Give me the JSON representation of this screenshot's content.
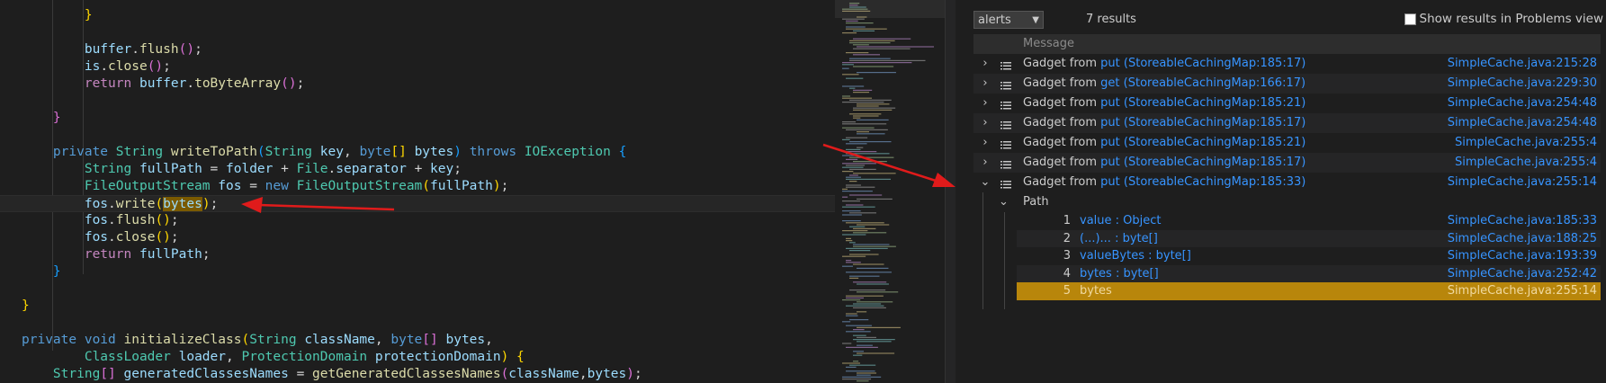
{
  "editor": {
    "lines": [
      {
        "tokens": [
          [
            "p",
            "        "
          ],
          [
            "b",
            "}"
          ]
        ]
      },
      {
        "tokens": [
          [
            "p",
            ""
          ]
        ]
      },
      {
        "tokens": [
          [
            "p",
            "        "
          ],
          [
            "v",
            "buffer"
          ],
          [
            "p",
            "."
          ],
          [
            "f",
            "flush"
          ],
          [
            "b2",
            "()"
          ],
          [
            "p",
            ";"
          ]
        ]
      },
      {
        "tokens": [
          [
            "p",
            "        "
          ],
          [
            "v",
            "is"
          ],
          [
            "p",
            "."
          ],
          [
            "f",
            "close"
          ],
          [
            "b2",
            "()"
          ],
          [
            "p",
            ";"
          ]
        ]
      },
      {
        "tokens": [
          [
            "p",
            "        "
          ],
          [
            "k",
            "return"
          ],
          [
            "p",
            " "
          ],
          [
            "v",
            "buffer"
          ],
          [
            "p",
            "."
          ],
          [
            "f",
            "toByteArray"
          ],
          [
            "b2",
            "()"
          ],
          [
            "p",
            ";"
          ]
        ]
      },
      {
        "tokens": [
          [
            "p",
            ""
          ]
        ]
      },
      {
        "tokens": [
          [
            "p",
            "    "
          ],
          [
            "b2",
            "}"
          ]
        ]
      },
      {
        "tokens": [
          [
            "p",
            ""
          ]
        ]
      },
      {
        "tokens": [
          [
            "p",
            "    "
          ],
          [
            "kw",
            "private"
          ],
          [
            "p",
            " "
          ],
          [
            "t",
            "String"
          ],
          [
            "p",
            " "
          ],
          [
            "f",
            "writeToPath"
          ],
          [
            "b3",
            "("
          ],
          [
            "t",
            "String"
          ],
          [
            "p",
            " "
          ],
          [
            "v",
            "key"
          ],
          [
            "p",
            ", "
          ],
          [
            "kw",
            "byte"
          ],
          [
            "b",
            "[]"
          ],
          [
            "p",
            " "
          ],
          [
            "v",
            "bytes"
          ],
          [
            "b3",
            ")"
          ],
          [
            "p",
            " "
          ],
          [
            "kw",
            "throws"
          ],
          [
            "p",
            " "
          ],
          [
            "t",
            "IOException"
          ],
          [
            "p",
            " "
          ],
          [
            "b3",
            "{"
          ]
        ]
      },
      {
        "tokens": [
          [
            "p",
            "        "
          ],
          [
            "t",
            "String"
          ],
          [
            "p",
            " "
          ],
          [
            "v",
            "fullPath"
          ],
          [
            "p",
            " = "
          ],
          [
            "v",
            "folder"
          ],
          [
            "p",
            " + "
          ],
          [
            "t",
            "File"
          ],
          [
            "p",
            "."
          ],
          [
            "v",
            "separator"
          ],
          [
            "p",
            " + "
          ],
          [
            "v",
            "key"
          ],
          [
            "p",
            ";"
          ]
        ]
      },
      {
        "tokens": [
          [
            "p",
            "        "
          ],
          [
            "t",
            "FileOutputStream"
          ],
          [
            "p",
            " "
          ],
          [
            "v",
            "fos"
          ],
          [
            "p",
            " = "
          ],
          [
            "kw",
            "new"
          ],
          [
            "p",
            " "
          ],
          [
            "t",
            "FileOutputStream"
          ],
          [
            "b",
            "("
          ],
          [
            "v",
            "fullPath"
          ],
          [
            "b",
            ")"
          ],
          [
            "p",
            ";"
          ]
        ]
      },
      {
        "tokens": [
          [
            "p",
            "        "
          ],
          [
            "v",
            "fos"
          ],
          [
            "p",
            "."
          ],
          [
            "f",
            "write"
          ],
          [
            "b",
            "("
          ],
          [
            "hl",
            "bytes"
          ],
          [
            "b",
            ")"
          ],
          [
            "p",
            ";"
          ]
        ],
        "current": true
      },
      {
        "tokens": [
          [
            "p",
            "        "
          ],
          [
            "v",
            "fos"
          ],
          [
            "p",
            "."
          ],
          [
            "f",
            "flush"
          ],
          [
            "b",
            "()"
          ],
          [
            "p",
            ";"
          ]
        ]
      },
      {
        "tokens": [
          [
            "p",
            "        "
          ],
          [
            "v",
            "fos"
          ],
          [
            "p",
            "."
          ],
          [
            "f",
            "close"
          ],
          [
            "b",
            "()"
          ],
          [
            "p",
            ";"
          ]
        ]
      },
      {
        "tokens": [
          [
            "p",
            "        "
          ],
          [
            "k",
            "return"
          ],
          [
            "p",
            " "
          ],
          [
            "v",
            "fullPath"
          ],
          [
            "p",
            ";"
          ]
        ]
      },
      {
        "tokens": [
          [
            "p",
            "    "
          ],
          [
            "b3",
            "}"
          ]
        ]
      },
      {
        "tokens": [
          [
            "p",
            ""
          ]
        ]
      },
      {
        "tokens": [
          [
            "b",
            "}"
          ]
        ]
      },
      {
        "tokens": [
          [
            "p",
            ""
          ]
        ]
      },
      {
        "tokens": [
          [
            "kw",
            "private"
          ],
          [
            "p",
            " "
          ],
          [
            "kw",
            "void"
          ],
          [
            "p",
            " "
          ],
          [
            "f",
            "initializeClass"
          ],
          [
            "b",
            "("
          ],
          [
            "t",
            "String"
          ],
          [
            "p",
            " "
          ],
          [
            "v",
            "className"
          ],
          [
            "p",
            ", "
          ],
          [
            "kw",
            "byte"
          ],
          [
            "b2",
            "[]"
          ],
          [
            "p",
            " "
          ],
          [
            "v",
            "bytes"
          ],
          [
            "p",
            ","
          ]
        ]
      },
      {
        "tokens": [
          [
            "p",
            "        "
          ],
          [
            "t",
            "ClassLoader"
          ],
          [
            "p",
            " "
          ],
          [
            "v",
            "loader"
          ],
          [
            "p",
            ", "
          ],
          [
            "t",
            "ProtectionDomain"
          ],
          [
            "p",
            " "
          ],
          [
            "v",
            "protectionDomain"
          ],
          [
            "b",
            ")"
          ],
          [
            "p",
            " "
          ],
          [
            "b",
            "{"
          ]
        ]
      },
      {
        "tokens": [
          [
            "p",
            "    "
          ],
          [
            "t",
            "String"
          ],
          [
            "b2",
            "[]"
          ],
          [
            "p",
            " "
          ],
          [
            "v",
            "generatedClassesNames"
          ],
          [
            "p",
            " = "
          ],
          [
            "f",
            "getGeneratedClassesNames"
          ],
          [
            "b2",
            "("
          ],
          [
            "v",
            "className"
          ],
          [
            "p",
            ","
          ],
          [
            "v",
            "bytes"
          ],
          [
            "b2",
            ")"
          ],
          [
            "p",
            ";"
          ]
        ]
      }
    ]
  },
  "panel": {
    "select_value": "alerts",
    "result_count": "7 results",
    "problems_label": "Show results in Problems view",
    "header_message": "Message",
    "results": [
      {
        "prefix": "Gadget from ",
        "link": "put (StoreableCachingMap:185:17)",
        "location": "SimpleCache.java:215:28",
        "expanded": false
      },
      {
        "prefix": "Gadget from ",
        "link": "get (StoreableCachingMap:166:17)",
        "location": "SimpleCache.java:229:30",
        "expanded": false
      },
      {
        "prefix": "Gadget from ",
        "link": "put (StoreableCachingMap:185:21)",
        "location": "SimpleCache.java:254:48",
        "expanded": false
      },
      {
        "prefix": "Gadget from ",
        "link": "put (StoreableCachingMap:185:17)",
        "location": "SimpleCache.java:254:48",
        "expanded": false
      },
      {
        "prefix": "Gadget from ",
        "link": "put (StoreableCachingMap:185:21)",
        "location": "SimpleCache.java:255:4",
        "expanded": false
      },
      {
        "prefix": "Gadget from ",
        "link": "put (StoreableCachingMap:185:17)",
        "location": "SimpleCache.java:255:4",
        "expanded": false
      },
      {
        "prefix": "Gadget from ",
        "link": "put (StoreableCachingMap:185:33)",
        "location": "SimpleCache.java:255:14",
        "expanded": true
      }
    ],
    "path_label": "Path",
    "path_steps": [
      {
        "num": "1",
        "name": "value : Object",
        "location": "SimpleCache.java:185:33"
      },
      {
        "num": "2",
        "name": "(...)... : byte[]",
        "location": "SimpleCache.java:188:25"
      },
      {
        "num": "3",
        "name": "valueBytes : byte[]",
        "location": "SimpleCache.java:193:39"
      },
      {
        "num": "4",
        "name": "bytes : byte[]",
        "location": "SimpleCache.java:252:42"
      },
      {
        "num": "5",
        "name": "bytes",
        "location": "SimpleCache.java:255:14",
        "selected": true
      }
    ]
  },
  "colors": {
    "arrow": "#e01b1b",
    "selected_row": "#b8860b",
    "link": "#3794ff"
  }
}
